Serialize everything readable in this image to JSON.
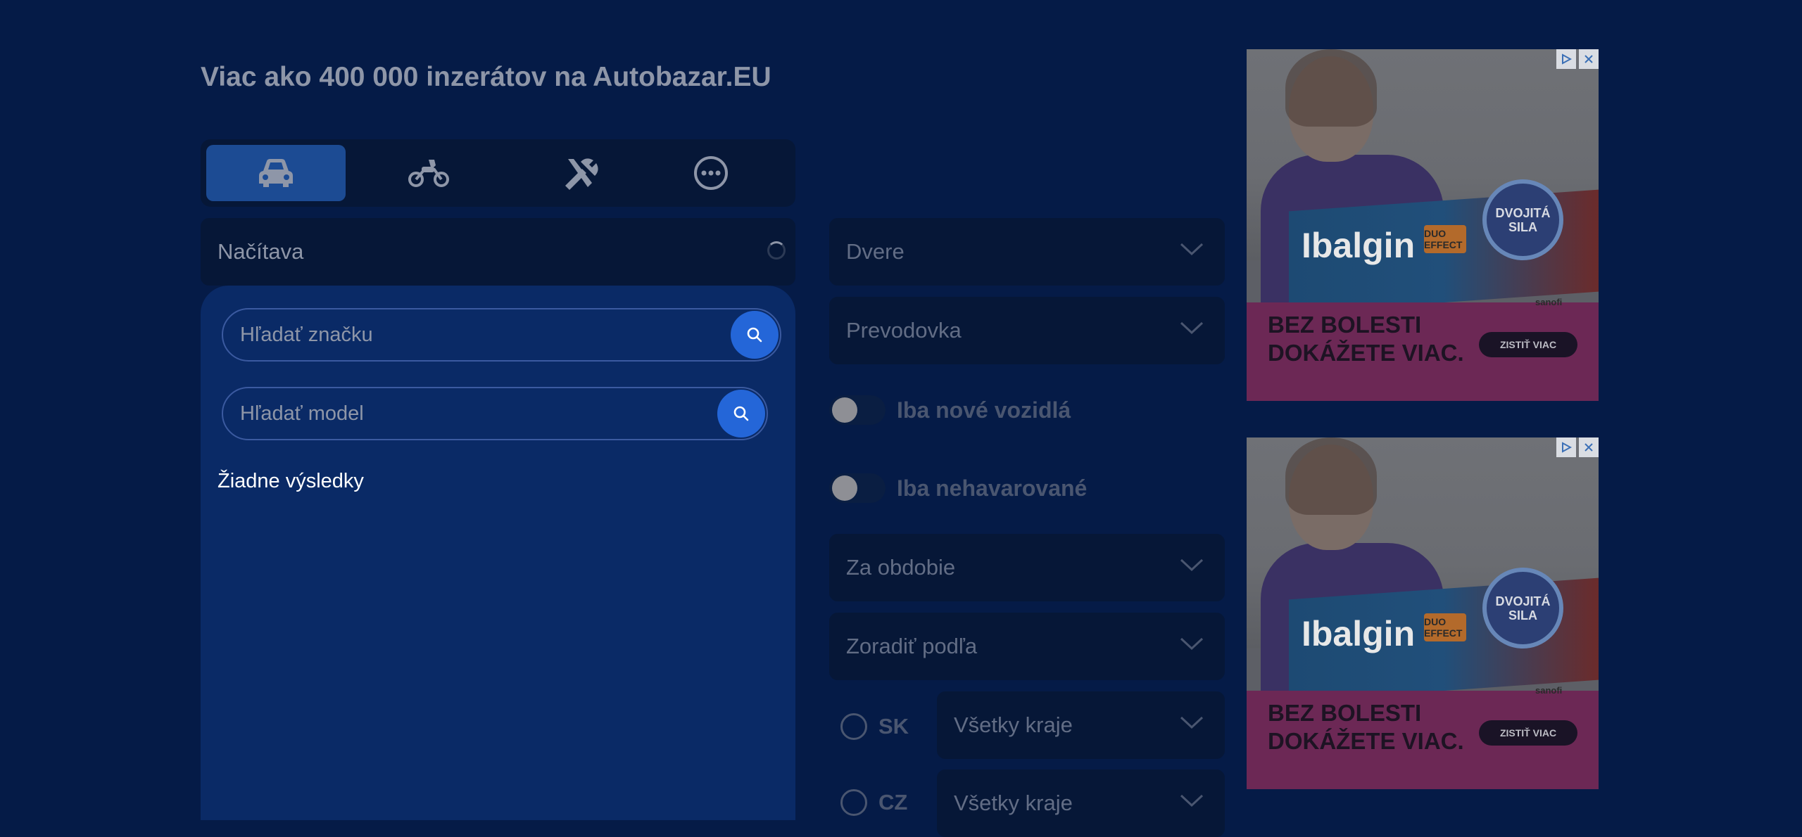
{
  "header": {
    "headline": "Viac ako 400 000 inzerátov na Autobazar.EU"
  },
  "vehicle_tabs": [
    {
      "icon": "car-icon",
      "active": true
    },
    {
      "icon": "motorcycle-icon",
      "active": false
    },
    {
      "icon": "tools-icon",
      "active": false
    },
    {
      "icon": "more-icon",
      "active": false
    }
  ],
  "brand_select": {
    "label": "Načítava"
  },
  "brand_search": {
    "placeholder": "Hľadať značku"
  },
  "model_search": {
    "placeholder": "Hľadať model"
  },
  "results": {
    "empty_text": "Žiadne výsledky"
  },
  "filters": {
    "doors": "Dvere",
    "transmission": "Prevodovka",
    "only_new": "Iba nové vozidlá",
    "undamaged": "Iba nehavarované",
    "period": "Za obdobie",
    "sort_by": "Zoradiť podľa",
    "country_sk": "SK",
    "regions_sk": "Všetky kraje",
    "country_cz": "CZ",
    "regions_cz": "Všetky kraje"
  },
  "ads": [
    {
      "brand": "Ibalgin",
      "product": "DUO EFFECT",
      "badge": "DVOJITÁ SILA",
      "headline_line1": "BEZ BOLESTI",
      "headline_line2": "DOKÁŽETE VIAC.",
      "cta": "ZISTIŤ VIAC",
      "maker": "sanofi"
    },
    {
      "brand": "Ibalgin",
      "product": "DUO EFFECT",
      "badge": "DVOJITÁ SILA",
      "headline_line1": "BEZ BOLESTI",
      "headline_line2": "DOKÁŽETE VIAC.",
      "cta": "ZISTIŤ VIAC",
      "maker": "sanofi"
    }
  ],
  "colors": {
    "background": "#051b47",
    "active_tab": "#1c4b93",
    "search_button": "#2466d8",
    "panel": "#0a2a66"
  }
}
